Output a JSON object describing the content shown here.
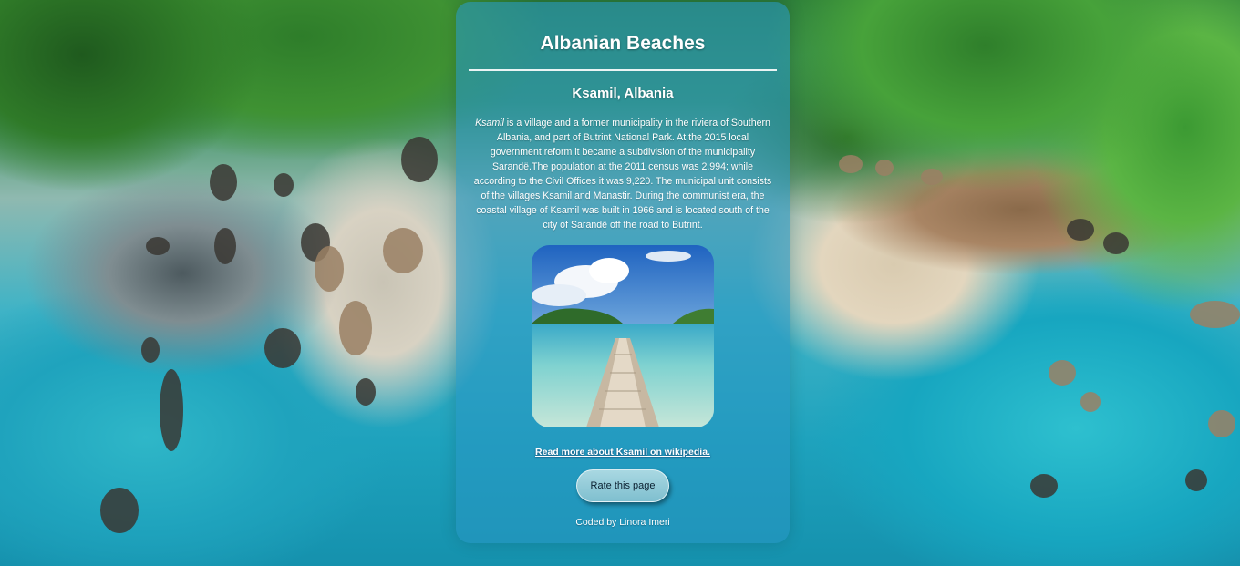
{
  "page": {
    "site_title": "Albanian Beaches",
    "beach_title": "Ksamil, Albania",
    "description_lead": "Ksamil",
    "description_rest": " is a village and a former municipality in the riviera of Southern Albania, and part of Butrint National Park. At the 2015 local government reform it became a subdivision of the municipality Sarandë.The population at the 2011 census was 2,994; while according to the Civil Offices it was 9,220. The municipal unit consists of the villages Ksamil and Manastir. During the communist era, the coastal village of Ksamil was built in 1966 and is located south of the city of Sarandë off the road to Butrint.",
    "photo_icon": "beach-pier-photo",
    "wiki_link_text": "Read more about Ksamil on wikipedia.",
    "rate_button_label": "Rate this page",
    "credit": "Coded by Linora Imeri"
  },
  "colors": {
    "card_background": "#2896c3",
    "text": "#ffffff",
    "button_background": "#a9d8e2"
  }
}
